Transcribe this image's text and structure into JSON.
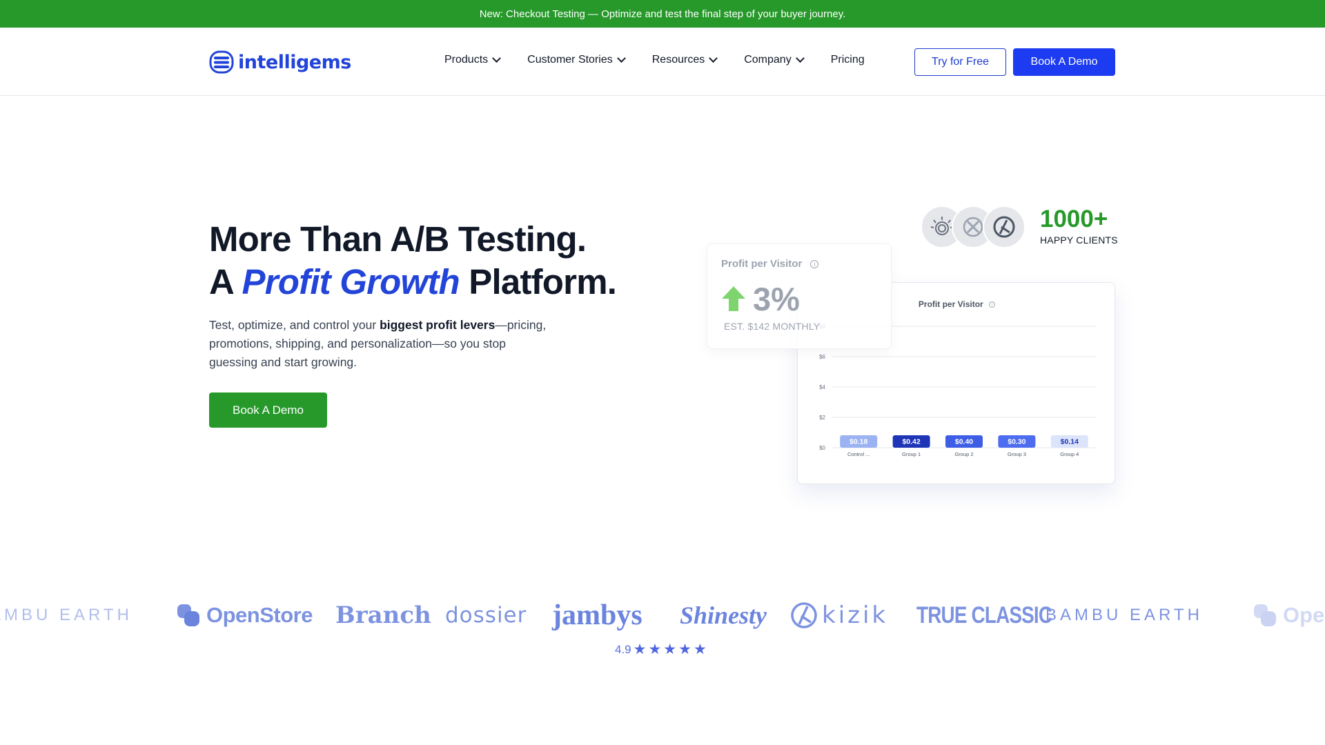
{
  "announcement": {
    "text": "New: Checkout Testing — Optimize and test the final step of your buyer journey."
  },
  "header": {
    "logo_text": "intelligems",
    "nav": [
      {
        "label": "Products",
        "has_dropdown": true
      },
      {
        "label": "Customer Stories",
        "has_dropdown": true
      },
      {
        "label": "Resources",
        "has_dropdown": true
      },
      {
        "label": "Company",
        "has_dropdown": true
      },
      {
        "label": "Pricing",
        "has_dropdown": false
      }
    ],
    "try_free_label": "Try for Free",
    "book_demo_label": "Book A Demo"
  },
  "hero": {
    "title_line1": "More Than A/B Testing.",
    "title_line2_pre": "A ",
    "title_line2_accent": "Profit Growth",
    "title_line2_post": " Platform.",
    "subtitle_pre": "Test, optimize, and control your ",
    "subtitle_bold": "biggest profit levers",
    "subtitle_post": "—pricing, promotions, shipping, and personalization—so you stop guessing and start growing.",
    "cta_label": "Book A Demo"
  },
  "clients": {
    "count": "1000+",
    "label": "HAPPY CLIENTS"
  },
  "profit_card": {
    "label": "Profit per Visitor",
    "info_glyph": "i",
    "value": "3%",
    "est": "EST. $142 MONTHLY"
  },
  "chart_data": {
    "type": "bar",
    "title": "Profit per Visitor",
    "categories": [
      "Control ...",
      "Group 1",
      "Group 2",
      "Group 3",
      "Group 4"
    ],
    "values": [
      0.18,
      0.42,
      0.4,
      0.3,
      0.14
    ],
    "value_labels": [
      "$0.18",
      "$0.42",
      "$0.40",
      "$0.30",
      "$0.14"
    ],
    "yticks": [
      "$0",
      "$2",
      "$4",
      "$6",
      "$8"
    ],
    "ytick_values": [
      0,
      2,
      4,
      6,
      8
    ],
    "ylim": [
      0,
      8
    ],
    "grid": true,
    "colors": [
      "#9bb3f3",
      "#1e35b8",
      "#3e5ee6",
      "#4d6cf0",
      "#dce4fb"
    ],
    "label_colors": [
      "#ffffff",
      "#ffffff",
      "#ffffff",
      "#ffffff",
      "#1e35b8"
    ]
  },
  "logos": [
    {
      "text": "BAMBU EARTH",
      "name": "bambu-earth-logo"
    },
    {
      "text": "OpenStore",
      "name": "openstore-logo"
    },
    {
      "text": "Branch",
      "name": "branch-logo"
    },
    {
      "text": "dossier",
      "name": "dossier-logo"
    },
    {
      "text": "jambys",
      "name": "jambys-logo"
    },
    {
      "text": "Shinesty",
      "name": "shinesty-logo"
    },
    {
      "text": "kizik",
      "name": "kizik-logo"
    },
    {
      "text": "TRUE CLASSIC",
      "name": "true-classic-logo"
    },
    {
      "text": "BAMBU EARTH",
      "name": "bambu-earth-logo-repeat"
    },
    {
      "text": "OpenStore",
      "name": "openstore-logo-repeat"
    }
  ],
  "rating": {
    "score": "4.9",
    "stars": 5
  },
  "colors": {
    "brand_blue": "#1d3bf0",
    "brand_green": "#26992a",
    "logo_blue": "#7d93e0"
  }
}
